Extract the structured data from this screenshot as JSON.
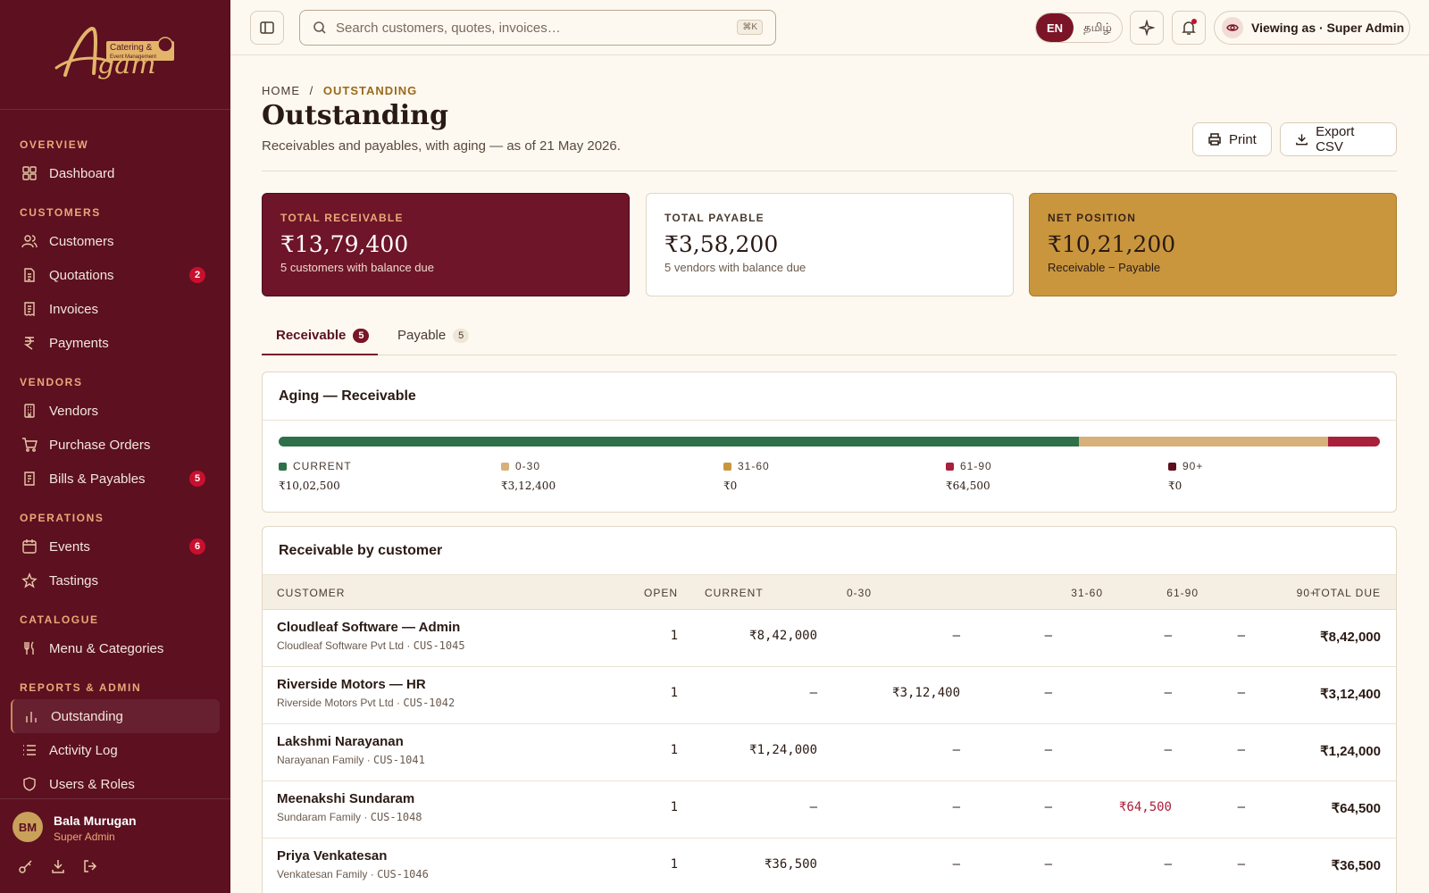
{
  "brand": {
    "logo_text": "Agam",
    "logo_tag": "Catering & Event Management"
  },
  "sidebar": {
    "sections": [
      {
        "title": "OVERVIEW",
        "items": [
          {
            "label": "Dashboard",
            "icon": "grid-icon"
          }
        ]
      },
      {
        "title": "CUSTOMERS",
        "items": [
          {
            "label": "Customers",
            "icon": "users-icon"
          },
          {
            "label": "Quotations",
            "icon": "document-icon",
            "badge": "2"
          },
          {
            "label": "Invoices",
            "icon": "receipt-icon"
          },
          {
            "label": "Payments",
            "icon": "rupee-icon"
          }
        ]
      },
      {
        "title": "VENDORS",
        "items": [
          {
            "label": "Vendors",
            "icon": "building-icon"
          },
          {
            "label": "Purchase Orders",
            "icon": "cart-icon"
          },
          {
            "label": "Bills & Payables",
            "icon": "bill-icon",
            "badge": "5"
          }
        ]
      },
      {
        "title": "OPERATIONS",
        "items": [
          {
            "label": "Events",
            "icon": "calendar-icon",
            "badge": "6"
          },
          {
            "label": "Tastings",
            "icon": "star-icon"
          }
        ]
      },
      {
        "title": "CATALOGUE",
        "items": [
          {
            "label": "Menu & Categories",
            "icon": "utensils-icon"
          }
        ]
      },
      {
        "title": "REPORTS & ADMIN",
        "items": [
          {
            "label": "Outstanding",
            "icon": "bar-chart-icon",
            "active": true
          },
          {
            "label": "Activity Log",
            "icon": "list-icon"
          },
          {
            "label": "Users & Roles",
            "icon": "shield-icon"
          }
        ]
      }
    ],
    "user": {
      "initials": "BM",
      "name": "Bala Murugan",
      "role": "Super Admin"
    }
  },
  "topbar": {
    "search_placeholder": "Search customers, quotes, invoices…",
    "search_shortcut": "⌘K",
    "lang_en": "EN",
    "lang_ta": "தமிழ்",
    "viewing_as": "Viewing as · Super Admin"
  },
  "page": {
    "breadcrumb_home": "HOME",
    "breadcrumb_sep": "/",
    "breadcrumb_current": "OUTSTANDING",
    "title": "Outstanding",
    "subtitle": "Receivables and payables, with aging — as of 21 May 2026.",
    "print_label": "Print",
    "export_label": "Export CSV"
  },
  "summary": {
    "receivable": {
      "label": "TOTAL RECEIVABLE",
      "value": "₹13,79,400",
      "note": "5 customers with balance due"
    },
    "payable": {
      "label": "TOTAL PAYABLE",
      "value": "₹3,58,200",
      "note": "5 vendors with balance due"
    },
    "net": {
      "label": "NET POSITION",
      "value": "₹10,21,200",
      "note": "Receivable − Payable"
    }
  },
  "tabs": [
    {
      "label": "Receivable",
      "count": "5",
      "active": true
    },
    {
      "label": "Payable",
      "count": "5",
      "active": false
    }
  ],
  "aging": {
    "title": "Aging — Receivable",
    "buckets": [
      {
        "label": "CURRENT",
        "value": "₹10,02,500",
        "amount": 1002500,
        "color": "#2e7048"
      },
      {
        "label": "0-30",
        "value": "₹3,12,400",
        "amount": 312400,
        "color": "#d8b07a"
      },
      {
        "label": "31-60",
        "value": "₹0",
        "amount": 0,
        "color": "#c9963e"
      },
      {
        "label": "61-90",
        "value": "₹64,500",
        "amount": 64500,
        "color": "#a8203a"
      },
      {
        "label": "90+",
        "value": "₹0",
        "amount": 0,
        "color": "#5c1020"
      }
    ]
  },
  "table": {
    "title": "Receivable by customer",
    "headers": [
      "CUSTOMER",
      "OPEN",
      "CURRENT",
      "0-30",
      "31-60",
      "61-90",
      "90+",
      "TOTAL DUE"
    ],
    "rows": [
      {
        "name": "Cloudleaf Software — Admin",
        "org": "Cloudleaf Software Pvt Ltd ·",
        "code": "CUS-1045",
        "open": "1",
        "current": "₹8,42,000",
        "d0_30": "—",
        "d31_60": "—",
        "d61_90": "—",
        "d90": "—",
        "total": "₹8,42,000"
      },
      {
        "name": "Riverside Motors — HR",
        "org": "Riverside Motors Pvt Ltd ·",
        "code": "CUS-1042",
        "open": "1",
        "current": "—",
        "d0_30": "₹3,12,400",
        "d31_60": "—",
        "d61_90": "—",
        "d90": "—",
        "total": "₹3,12,400"
      },
      {
        "name": "Lakshmi Narayanan",
        "org": "Narayanan Family ·",
        "code": "CUS-1041",
        "open": "1",
        "current": "₹1,24,000",
        "d0_30": "—",
        "d31_60": "—",
        "d61_90": "—",
        "d90": "—",
        "total": "₹1,24,000"
      },
      {
        "name": "Meenakshi Sundaram",
        "org": "Sundaram Family ·",
        "code": "CUS-1048",
        "open": "1",
        "current": "—",
        "d0_30": "—",
        "d31_60": "—",
        "d61_90": "₹64,500",
        "d90": "—",
        "total": "₹64,500"
      },
      {
        "name": "Priya Venkatesan",
        "org": "Venkatesan Family ·",
        "code": "CUS-1046",
        "open": "1",
        "current": "₹36,500",
        "d0_30": "—",
        "d31_60": "—",
        "d61_90": "—",
        "d90": "—",
        "total": "₹36,500"
      }
    ]
  }
}
